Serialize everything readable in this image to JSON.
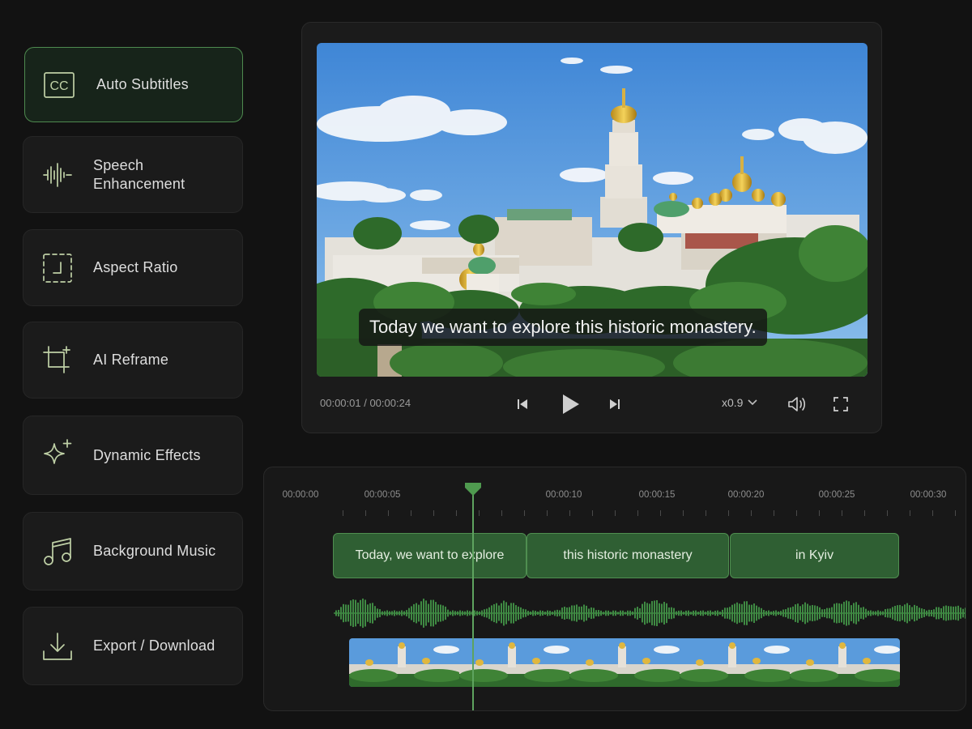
{
  "sidebar": {
    "items": [
      {
        "label": "Auto Subtitles",
        "icon": "cc-icon",
        "active": true,
        "cc_text": "CC"
      },
      {
        "label": "Speech\nEnhancement",
        "icon": "waveform-icon",
        "active": false
      },
      {
        "label": "Aspect Ratio",
        "icon": "aspect-ratio-icon",
        "active": false
      },
      {
        "label": "AI Reframe",
        "icon": "crop-sparkle-icon",
        "active": false
      },
      {
        "label": "Dynamic Effects",
        "icon": "sparkle-icon",
        "active": false
      },
      {
        "label": "Background Music",
        "icon": "music-note-icon",
        "active": false
      },
      {
        "label": "Export / Download",
        "icon": "download-icon",
        "active": false
      }
    ]
  },
  "player": {
    "caption": "Today we want to explore this historic monastery.",
    "current_time": "00:00:01",
    "duration": "00:00:24",
    "time_display": "00:00:01 / 00:00:24",
    "speed": "x0.9",
    "controls": [
      "skip-back-icon",
      "play-icon",
      "skip-forward-icon",
      "chevron-down-icon",
      "volume-icon",
      "fullscreen-icon"
    ]
  },
  "timeline": {
    "ruler_labels": [
      "00:00:00",
      "00:00:05",
      "00:00:10",
      "00:00:15",
      "00:00:20",
      "00:00:25",
      "00:00:30"
    ],
    "subtitle_clips": [
      {
        "text": "Today, we want to explore"
      },
      {
        "text": "this historic monastery"
      },
      {
        "text": "in Kyiv"
      }
    ],
    "filmstrip_frames": 5
  },
  "colors": {
    "background": "#121212",
    "panel": "#1b1b1b",
    "accent": "#4e8a4f",
    "clip_fill": "#2f5f33",
    "waveform": "#3f8a43",
    "icon": "#bfd0a6"
  }
}
